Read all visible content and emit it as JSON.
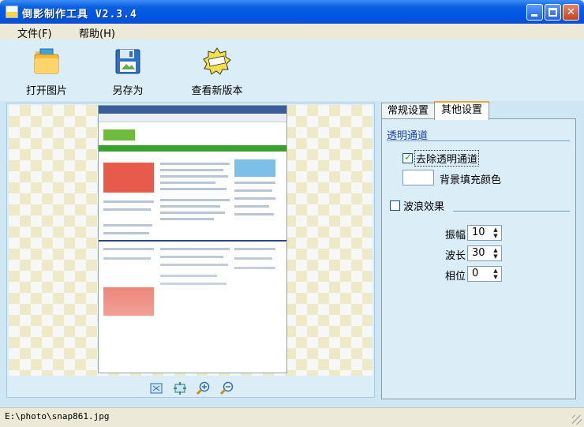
{
  "window": {
    "title": "倒影制作工具 V2.3.4",
    "controls": [
      "minimize",
      "maximize",
      "close"
    ]
  },
  "menu": {
    "items": [
      {
        "label": "文件(F)"
      },
      {
        "label": "帮助(H)"
      }
    ]
  },
  "toolbar": {
    "buttons": [
      {
        "label": "打开图片",
        "icon": "open-folder-icon"
      },
      {
        "label": "另存为",
        "icon": "save-floppy-icon"
      },
      {
        "label": "查看新版本",
        "icon": "extra-badge-icon"
      }
    ]
  },
  "preview": {
    "zoom_buttons": [
      "fit-icon",
      "actual-size-icon",
      "zoom-in-icon",
      "zoom-out-icon"
    ]
  },
  "tabs": [
    {
      "label": "常规设置",
      "active": false
    },
    {
      "label": "其他设置",
      "active": true
    }
  ],
  "settings": {
    "transparency": {
      "group_label": "透明通道",
      "remove_alpha_label": "去除透明通道",
      "remove_alpha_checked": true,
      "bg_fill_label": "背景填充颜色",
      "bg_fill_color": "#ffffff"
    },
    "wave": {
      "checkbox_label": "波浪效果",
      "checked": false,
      "amplitude_label": "振幅",
      "amplitude_value": "10",
      "wavelength_label": "波长",
      "wavelength_value": "30",
      "phase_label": "相位",
      "phase_value": "0"
    }
  },
  "status": {
    "path": "E:\\photo\\snap861.jpg"
  },
  "colors": {
    "titlebar": "#0055e5",
    "toolbar_bg": "#dbeef8",
    "accent_tab": "#f0a23a"
  }
}
